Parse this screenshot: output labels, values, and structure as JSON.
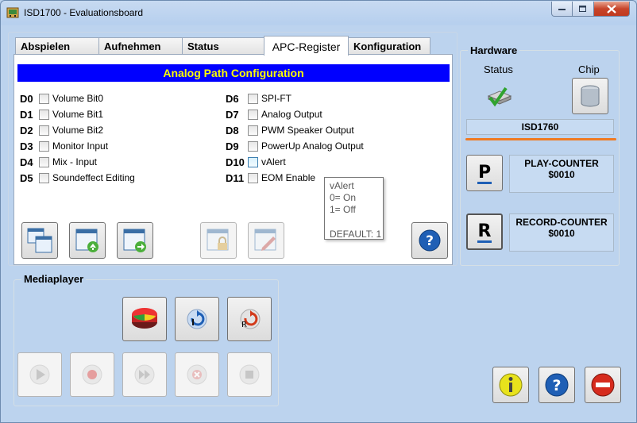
{
  "window": {
    "title": "ISD1700 - Evaluationsboard"
  },
  "tabs": [
    {
      "label": "Abspielen",
      "active": false
    },
    {
      "label": "Aufnehmen",
      "active": false
    },
    {
      "label": "Status",
      "active": false
    },
    {
      "label": "APC-Register",
      "active": true
    },
    {
      "label": "Konfiguration",
      "active": false
    }
  ],
  "apc": {
    "banner": "Analog Path Configuration",
    "left": [
      {
        "code": "D0",
        "label": "Volume Bit0"
      },
      {
        "code": "D1",
        "label": "Volume Bit1"
      },
      {
        "code": "D2",
        "label": "Volume Bit2"
      },
      {
        "code": "D3",
        "label": "Monitor Input"
      },
      {
        "code": "D4",
        "label": "Mix - Input"
      },
      {
        "code": "D5",
        "label": "Soundeffect Editing"
      }
    ],
    "right": [
      {
        "code": "D6",
        "label": "SPI-FT"
      },
      {
        "code": "D7",
        "label": "Analog Output"
      },
      {
        "code": "D8",
        "label": "PWM Speaker Output"
      },
      {
        "code": "D9",
        "label": "PowerUp Analog Output"
      },
      {
        "code": "D10",
        "label": "vAlert"
      },
      {
        "code": "D11",
        "label": "EOM Enable"
      }
    ],
    "tooltip": {
      "title": "vAlert",
      "line1": "0= On",
      "line2": "1= Off",
      "default": "DEFAULT: 1"
    }
  },
  "mediaplayer": {
    "label": "Mediaplayer"
  },
  "hardware": {
    "label": "Hardware",
    "status_label": "Status",
    "chip_label": "Chip",
    "chip_name": "ISD1760",
    "play_counter_label": "PLAY-COUNTER",
    "play_counter_value": "$0010",
    "record_counter_label": "RECORD-COUNTER",
    "record_counter_value": "$0010",
    "play_button_letter": "P",
    "record_button_letter": "R"
  },
  "colors": {
    "banner_bg": "#0000ff",
    "banner_fg": "#ffff00",
    "window_bg": "#bcd3ee",
    "accent_line": "#f07a22"
  }
}
